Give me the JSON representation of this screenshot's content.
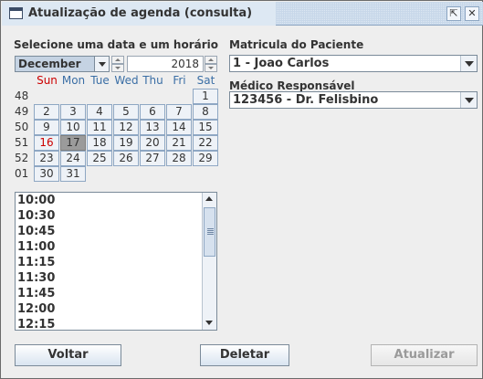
{
  "window": {
    "title": "Atualização de agenda (consulta)"
  },
  "left": {
    "date_label": "Selecione uma data e um horário"
  },
  "calendar": {
    "month": "December",
    "year": "2018",
    "weekdays": [
      "Sun",
      "Mon",
      "Tue",
      "Wed",
      "Thu",
      "Fri",
      "Sat"
    ],
    "weeks": [
      {
        "num": "48",
        "days": [
          "",
          "",
          "",
          "",
          "",
          "",
          "1"
        ]
      },
      {
        "num": "49",
        "days": [
          "2",
          "3",
          "4",
          "5",
          "6",
          "7",
          "8"
        ]
      },
      {
        "num": "50",
        "days": [
          "9",
          "10",
          "11",
          "12",
          "13",
          "14",
          "15"
        ]
      },
      {
        "num": "51",
        "days": [
          "16",
          "17",
          "18",
          "19",
          "20",
          "21",
          "22"
        ]
      },
      {
        "num": "52",
        "days": [
          "23",
          "24",
          "25",
          "26",
          "27",
          "28",
          "29"
        ]
      },
      {
        "num": "01",
        "days": [
          "30",
          "31",
          "",
          "",
          "",
          "",
          ""
        ]
      }
    ],
    "selected_day": "17",
    "today_day": "16"
  },
  "times": [
    "10:00",
    "10:30",
    "10:45",
    "11:00",
    "11:15",
    "11:30",
    "11:45",
    "12:00",
    "12:15"
  ],
  "right": {
    "patient_label": "Matricula do Paciente",
    "patient_value": "1 - Joao Carlos",
    "doctor_label": "Médico Responsável",
    "doctor_value": "123456 - Dr. Felisbino"
  },
  "buttons": {
    "back": "Voltar",
    "delete": "Deletar",
    "update": "Atualizar"
  },
  "colors": {
    "sunday": "#cc0000",
    "weekday_header": "#3a6ea5",
    "selected_day_bg": "#9b9b9b"
  }
}
